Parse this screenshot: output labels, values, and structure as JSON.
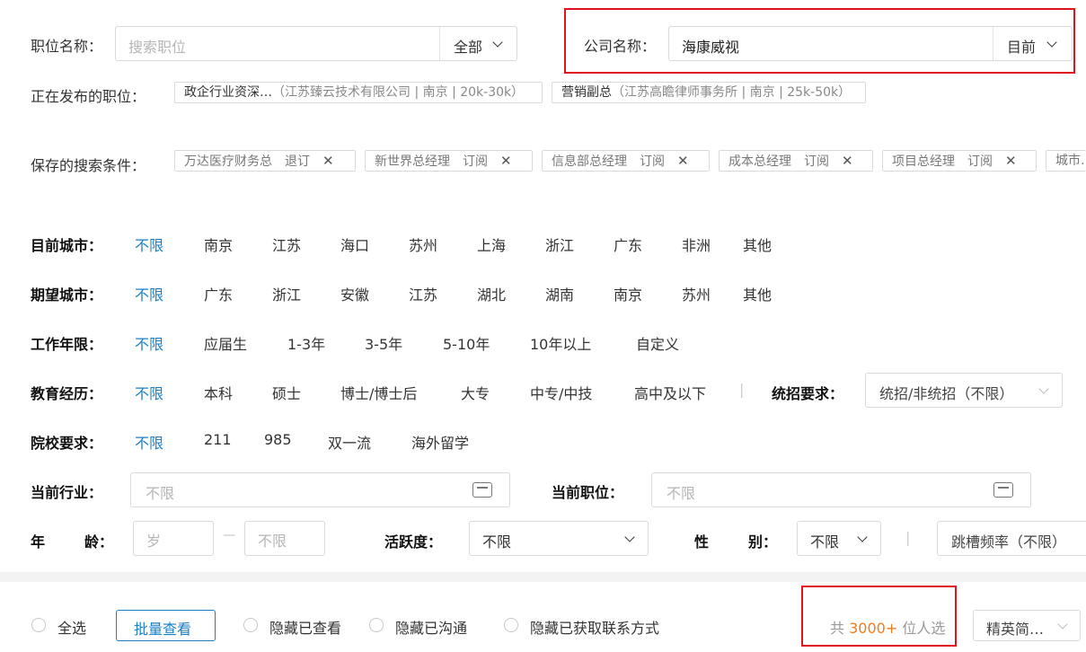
{
  "search": {
    "job_label": "职位名称：",
    "job_placeholder": "搜索职位",
    "job_scope": "全部",
    "company_label": "公司名称：",
    "company_value": "海康威视",
    "company_scope": "目前"
  },
  "publishing": {
    "label": "正在发布的职位：",
    "items": [
      {
        "title": "政企行业资深…",
        "detail": "（江苏臻云技术有限公司 | 南京 | 20k-30k）"
      },
      {
        "title": "营销副总",
        "detail": "（江苏高瞻律师事务所 | 南京 | 25k-50k）"
      }
    ]
  },
  "saved": {
    "label": "保存的搜索条件：",
    "items": [
      {
        "name": "万达医疗财务总",
        "action": "退订"
      },
      {
        "name": "新世界总经理",
        "action": "订阅"
      },
      {
        "name": "信息部总经理",
        "action": "订阅"
      },
      {
        "name": "成本总经理",
        "action": "订阅"
      },
      {
        "name": "项目总经理",
        "action": "订阅"
      },
      {
        "name": "城市…",
        "action": ""
      }
    ],
    "close_glyph": "✕"
  },
  "filters": {
    "current_city": {
      "label": "目前城市：",
      "options": [
        "不限",
        "南京",
        "江苏",
        "海口",
        "苏州",
        "上海",
        "浙江",
        "广东",
        "非洲",
        "其他"
      ]
    },
    "expected_city": {
      "label": "期望城市：",
      "options": [
        "不限",
        "广东",
        "浙江",
        "安徽",
        "江苏",
        "湖北",
        "湖南",
        "南京",
        "苏州",
        "其他"
      ]
    },
    "work_years": {
      "label": "工作年限：",
      "options": [
        "不限",
        "应届生",
        "1-3年",
        "3-5年",
        "5-10年",
        "10年以上",
        "自定义"
      ]
    },
    "education": {
      "label": "教育经历：",
      "options": [
        "不限",
        "本科",
        "硕士",
        "博士/博士后",
        "大专",
        "中专/中技",
        "高中及以下"
      ]
    },
    "unified": {
      "label": "统招要求：",
      "value": "统招/非统招（不限）"
    },
    "school": {
      "label": "院校要求：",
      "options": [
        "不限",
        "211",
        "985",
        "双一流",
        "海外留学"
      ]
    },
    "industry": {
      "label": "当前行业：",
      "placeholder": "不限"
    },
    "position": {
      "label": "当前职位：",
      "placeholder": "不限"
    },
    "age": {
      "label_a": "年",
      "label_b": "龄：",
      "min_placeholder": "岁",
      "dash": "—",
      "max_placeholder": "不限"
    },
    "activity": {
      "label": "活跃度：",
      "value": "不限"
    },
    "gender": {
      "label_a": "性",
      "label_b": "别：",
      "value": "不限"
    },
    "divider": "|",
    "job_hopping": {
      "value": "跳槽频率（不限）"
    }
  },
  "bottom": {
    "select_all": "全选",
    "batch_view": "批量查看",
    "hide_viewed": "隐藏已查看",
    "hide_contacted": "隐藏已沟通",
    "hide_contact_obtained": "隐藏已获取联系方式",
    "total_prefix": "共",
    "total_count": "3000+",
    "total_suffix": "位人选",
    "view_mode": "精英简…"
  },
  "colors": {
    "accent": "#1a7fc6",
    "highlight": "#e0141e",
    "count": "#f07c1e"
  }
}
